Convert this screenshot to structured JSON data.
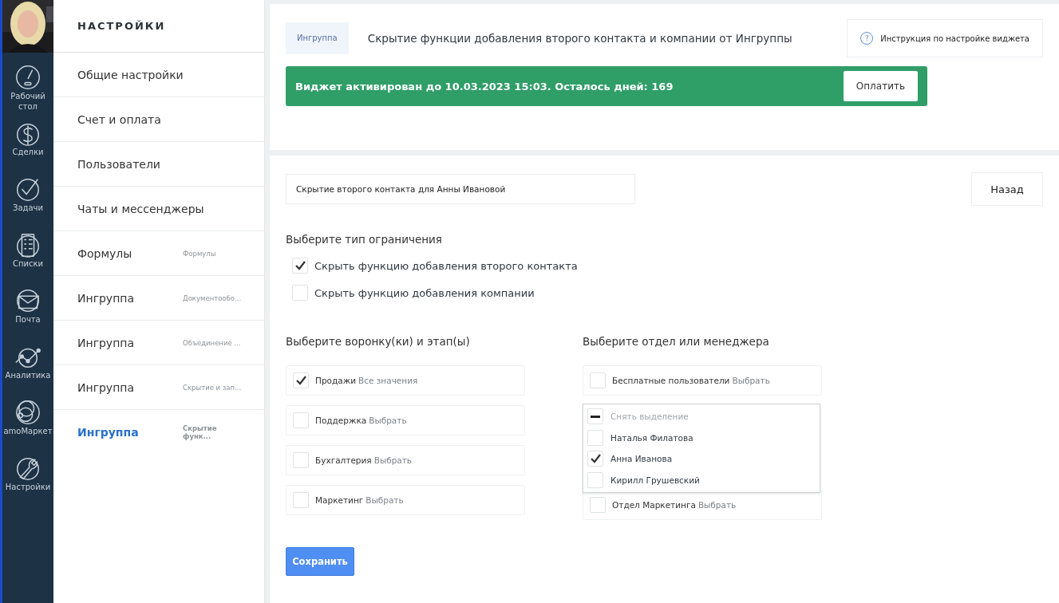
{
  "nav": {
    "items": [
      {
        "label": "Рабочий стол",
        "kind": "gauge"
      },
      {
        "label": "Сделки",
        "kind": "dollar"
      },
      {
        "label": "Задачи",
        "kind": "check"
      },
      {
        "label": "Списки",
        "kind": "list"
      },
      {
        "label": "Почта",
        "kind": "mail"
      },
      {
        "label": "Аналитика",
        "kind": "chart"
      },
      {
        "label": "amoМаркет",
        "kind": "rings"
      },
      {
        "label": "Настройки",
        "kind": "wrench"
      }
    ]
  },
  "sidebar": {
    "title": "НАСТРОЙКИ",
    "items": [
      {
        "label": "Общие настройки",
        "selected": false
      },
      {
        "label": "Счет и оплата",
        "selected": false
      },
      {
        "label": "Пользователи",
        "selected": false
      },
      {
        "label": "Чаты и мессенджеры",
        "selected": false
      },
      {
        "label": "Формулы",
        "note": "Формулы",
        "selected": false
      },
      {
        "label": "Ингруппа",
        "note": "Документообо...",
        "selected": false
      },
      {
        "label": "Ингруппа",
        "note": "Объединение ...",
        "selected": false
      },
      {
        "label": "Ингруппа",
        "note": "Скрытие и зап...",
        "selected": false
      },
      {
        "label": "Ингруппа",
        "note": "Скрытие функ...",
        "selected": true
      }
    ]
  },
  "header": {
    "badge": "Ингруппа",
    "title": "Скрытие функции добавления второго контакта и компании от Ингруппы",
    "help_icon": "?",
    "help_link": "Инструкция по настройке виджета"
  },
  "banner": {
    "text": "Виджет активирован до 10.03.2023 15:03. Осталось дней: 169",
    "button": "Оплатить"
  },
  "form": {
    "name_field": "Скрытие второго контакта для Анны Ивановой",
    "back_button": "Назад",
    "restriction_title": "Выберите тип ограничения",
    "restrictions": [
      {
        "label": "Скрыть функцию добавления второго контакта",
        "checked": true
      },
      {
        "label": "Скрыть функцию добавления компании",
        "checked": false
      }
    ],
    "funnels_title": "Выберите воронку(ки) и этап(ы)",
    "funnels": [
      {
        "name": "Продажи",
        "action": "Все значения",
        "checked": true
      },
      {
        "name": "Поддержка",
        "action": "Выбрать",
        "checked": false
      },
      {
        "name": "Бухгалтерия",
        "action": "Выбрать",
        "checked": false
      },
      {
        "name": "Маркетинг",
        "action": "Выбрать",
        "checked": false
      }
    ],
    "managers_title": "Выберите отдел или менеджера",
    "departments": [
      {
        "name": "Бесплатные пользователи",
        "action": "Выбрать",
        "checked": false
      },
      {
        "name": "Отдел Маркетинга",
        "action": "Выбрать",
        "checked": false
      }
    ],
    "dropdown": [
      {
        "kind": "deselect",
        "label": "Снять выделение",
        "indeterminate": true
      },
      {
        "kind": "checkbox",
        "label": "Наталья Филатова",
        "checked": false
      },
      {
        "kind": "checkbox",
        "label": "Анна Иванова",
        "checked": true
      },
      {
        "kind": "checkbox",
        "label": "Кирилл Грушевский",
        "checked": false
      }
    ],
    "save_button": "Сохранить"
  }
}
